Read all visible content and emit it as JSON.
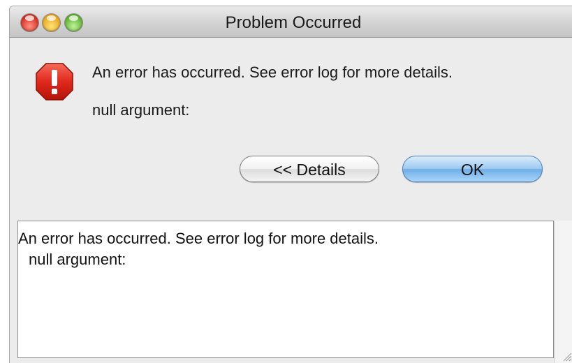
{
  "window": {
    "title": "Problem Occurred"
  },
  "dialog": {
    "icon": "error-stop-icon",
    "message": "An error has occurred. See error log for more details.",
    "submessage": "null argument:",
    "details_button_label": "<< Details",
    "ok_button_label": "OK"
  },
  "details": {
    "lines": [
      "An error has occurred. See error log for more details.",
      "null argument:"
    ]
  },
  "colors": {
    "stop_icon": "#e0281c",
    "ok_button": "#7fb8ea"
  }
}
